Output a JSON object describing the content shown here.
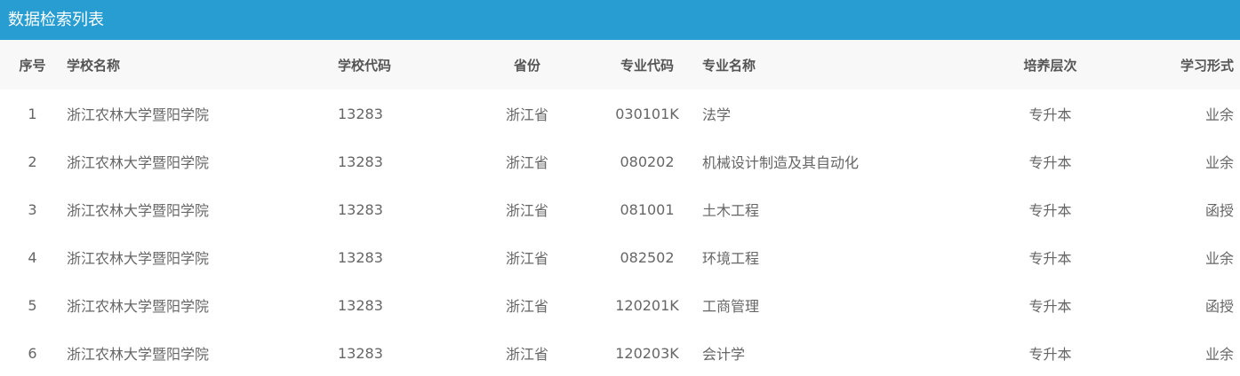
{
  "header": {
    "title": "数据检索列表"
  },
  "table": {
    "columns": [
      "序号",
      "学校名称",
      "学校代码",
      "省份",
      "专业代码",
      "专业名称",
      "培养层次",
      "学习形式"
    ],
    "rows": [
      [
        "1",
        "浙江农林大学暨阳学院",
        "13283",
        "浙江省",
        "030101K",
        "法学",
        "专升本",
        "业余"
      ],
      [
        "2",
        "浙江农林大学暨阳学院",
        "13283",
        "浙江省",
        "080202",
        "机械设计制造及其自动化",
        "专升本",
        "业余"
      ],
      [
        "3",
        "浙江农林大学暨阳学院",
        "13283",
        "浙江省",
        "081001",
        "土木工程",
        "专升本",
        "函授"
      ],
      [
        "4",
        "浙江农林大学暨阳学院",
        "13283",
        "浙江省",
        "082502",
        "环境工程",
        "专升本",
        "业余"
      ],
      [
        "5",
        "浙江农林大学暨阳学院",
        "13283",
        "浙江省",
        "120201K",
        "工商管理",
        "专升本",
        "函授"
      ],
      [
        "6",
        "浙江农林大学暨阳学院",
        "13283",
        "浙江省",
        "120203K",
        "会计学",
        "专升本",
        "业余"
      ]
    ]
  }
}
